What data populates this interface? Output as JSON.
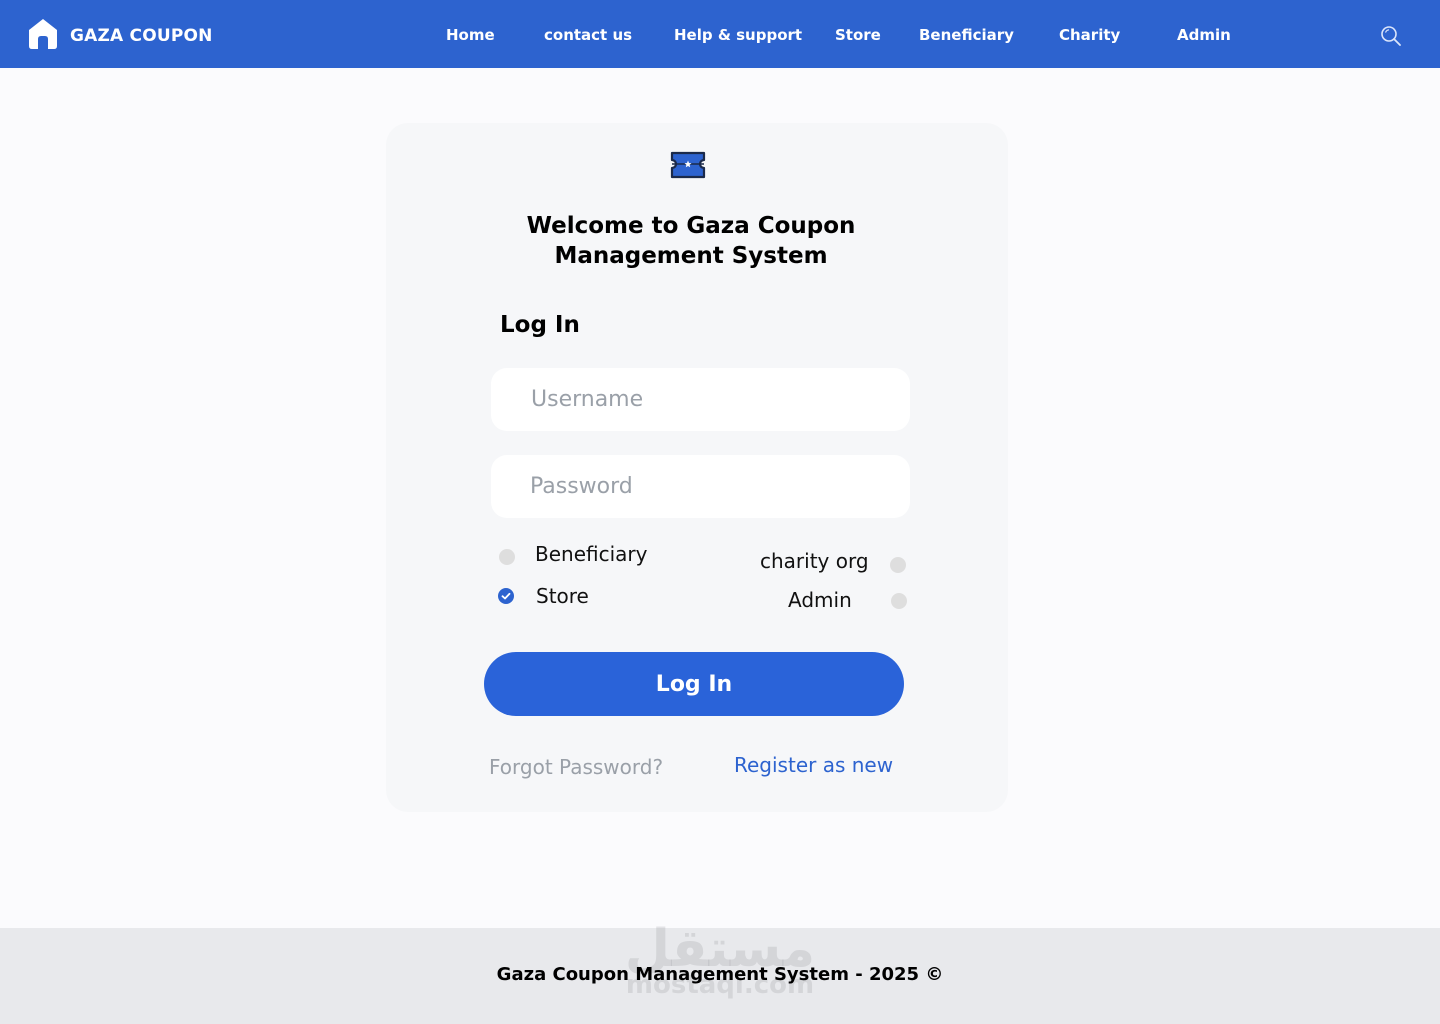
{
  "header": {
    "brand": "GAZA COUPON",
    "nav": [
      "Home",
      "contact us",
      "Help & support",
      "Store",
      "Beneficiary",
      "Charity",
      "Admin"
    ]
  },
  "login": {
    "welcome": "Welcome to Gaza Coupon Management System",
    "heading": "Log In",
    "username_placeholder": "Username",
    "password_placeholder": "Password",
    "roles": [
      {
        "label": "Beneficiary",
        "checked": false
      },
      {
        "label": "Store",
        "checked": true
      },
      {
        "label": "charity org",
        "checked": false
      },
      {
        "label": "Admin",
        "checked": false
      }
    ],
    "button": "Log In",
    "forgot": "Forgot Password?",
    "register": "Register as new"
  },
  "footer": {
    "text": "Gaza Coupon Management System - 2025 ©",
    "watermark_arabic": "مستقل",
    "watermark_latin": "mostaql.com"
  },
  "colors": {
    "accent": "#2d63cf",
    "button": "#2a63d9",
    "footer_bg": "#e8e9ec"
  },
  "icons": [
    "home-icon",
    "search-icon",
    "ticket-icon",
    "checkmark-icon"
  ]
}
